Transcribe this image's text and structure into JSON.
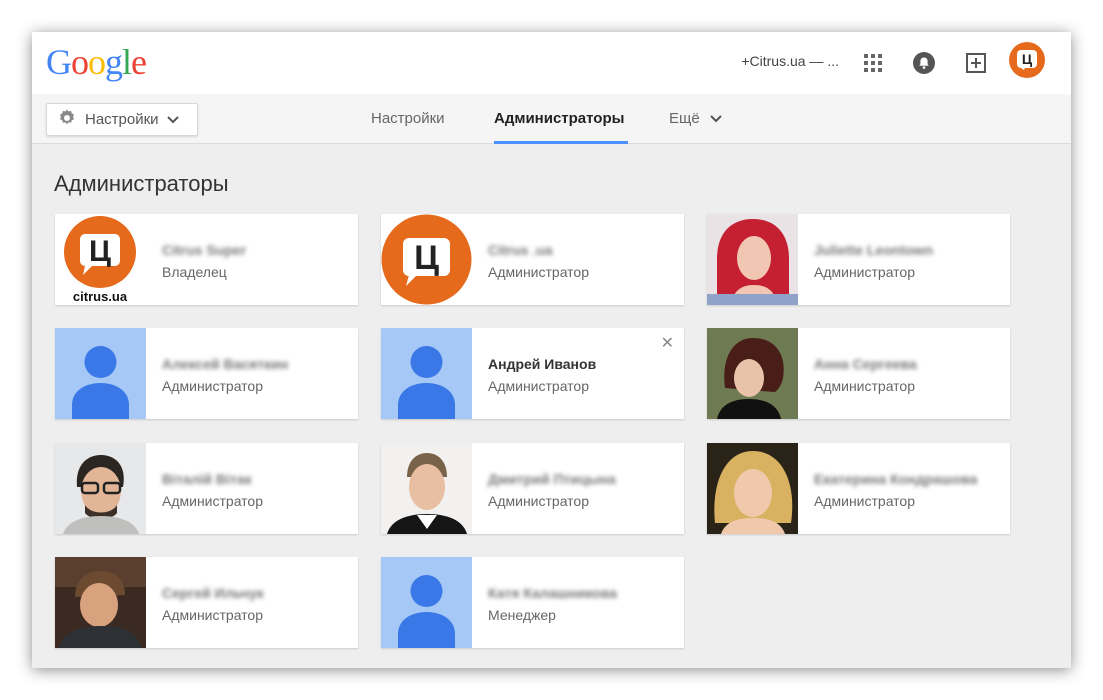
{
  "header": {
    "logo_letters": [
      {
        "ch": "G",
        "color": "#4285f4"
      },
      {
        "ch": "o",
        "color": "#ea4335"
      },
      {
        "ch": "o",
        "color": "#fbbc05"
      },
      {
        "ch": "g",
        "color": "#4285f4"
      },
      {
        "ch": "l",
        "color": "#34a853"
      },
      {
        "ch": "e",
        "color": "#ea4335"
      }
    ],
    "account_label": "+Citrus.ua — ...",
    "avatar_letter": "Ц",
    "icons": [
      "apps-grid-icon",
      "notifications-bell-icon",
      "share-plus-icon"
    ]
  },
  "subnav": {
    "settings_button": "Настройки",
    "tabs": [
      {
        "label": "Настройки",
        "active": false
      },
      {
        "label": "Администраторы",
        "active": true
      },
      {
        "label": "Ещё",
        "active": false
      }
    ]
  },
  "page": {
    "title": "Администраторы"
  },
  "admins": [
    {
      "name": "Citrus Super",
      "role": "Владелец",
      "photo": "citrus-logo",
      "blurred": true
    },
    {
      "name": "Citrus .ua",
      "role": "Администратор",
      "photo": "citrus-circle",
      "blurred": true
    },
    {
      "name": "Juliette Leontown",
      "role": "Администратор",
      "photo": "photo-redhair",
      "blurred": true
    },
    {
      "name": "Алексей Васяткин",
      "role": "Администратор",
      "photo": "placeholder",
      "blurred": true
    },
    {
      "name": "Андрей Иванов",
      "role": "Администратор",
      "photo": "placeholder",
      "blurred": false,
      "removable": true
    },
    {
      "name": "Анна Сергеева",
      "role": "Администратор",
      "photo": "photo-darkhair",
      "blurred": true
    },
    {
      "name": "Віталій Вітак",
      "role": "Администратор",
      "photo": "photo-glasses",
      "blurred": true
    },
    {
      "name": "Дмитрий Птицына",
      "role": "Администратор",
      "photo": "photo-man-shirt",
      "blurred": true
    },
    {
      "name": "Екатерина Кондрашова",
      "role": "Администратор",
      "photo": "photo-blonde",
      "blurred": true
    },
    {
      "name": "Сергей Ильчук",
      "role": "Администратор",
      "photo": "photo-man-dark",
      "blurred": true
    },
    {
      "name": "Катя Калашникова",
      "role": "Менеджер",
      "photo": "placeholder",
      "blurred": true
    }
  ],
  "close_symbol": "✕",
  "citrus_logo_caption": "citrus.ua",
  "colors": {
    "accent": "#4d90fe",
    "citrus_orange": "#e66a1b",
    "placeholder_bg": "#a5c8f6",
    "placeholder_figure": "#3b78e7"
  }
}
